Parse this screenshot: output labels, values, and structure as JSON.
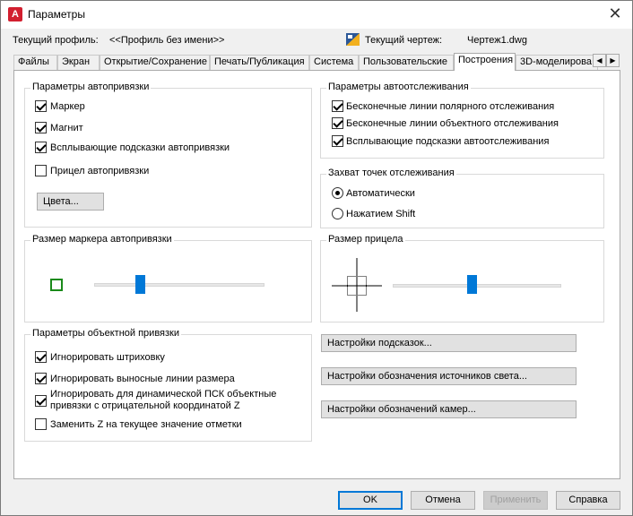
{
  "window": {
    "title": "Параметры",
    "app_icon_letter": "A"
  },
  "header": {
    "profile_label": "Текущий профиль:",
    "profile_value": "<<Профиль без имени>>",
    "drawing_label": "Текущий чертеж:",
    "drawing_value": "Чертеж1.dwg"
  },
  "tabs": [
    {
      "label": "Файлы"
    },
    {
      "label": "Экран"
    },
    {
      "label": "Открытие/Сохранение"
    },
    {
      "label": "Печать/Публикация"
    },
    {
      "label": "Система"
    },
    {
      "label": "Пользовательские"
    },
    {
      "label": "Построения",
      "active": true
    },
    {
      "label": "3D-моделирова"
    }
  ],
  "autosnap": {
    "title": "Параметры автопривязки",
    "marker": {
      "label": "Маркер",
      "checked": true
    },
    "magnet": {
      "label": "Магнит",
      "checked": true
    },
    "tooltips": {
      "label": "Всплывающие подсказки автопривязки",
      "checked": true
    },
    "aperture": {
      "label": "Прицел автопривязки",
      "checked": false
    },
    "colors_button": "Цвета..."
  },
  "autotrack": {
    "title": "Параметры автоотслеживания",
    "polar": {
      "label": "Бесконечные линии полярного отслеживания",
      "checked": true
    },
    "object": {
      "label": "Бесконечные линии объектного отслеживания",
      "checked": true
    },
    "tooltips": {
      "label": "Всплывающие подсказки автоотслеживания",
      "checked": true
    }
  },
  "acquisition": {
    "title": "Захват точек отслеживания",
    "auto": {
      "label": "Автоматически",
      "selected": true
    },
    "shift": {
      "label": "Нажатием Shift",
      "selected": false
    }
  },
  "marker_size": {
    "title": "Размер маркера автопривязки",
    "value_fraction": 0.27,
    "marker_color": "#1a8a1a"
  },
  "aperture_size": {
    "title": "Размер прицела",
    "value_fraction": 0.47
  },
  "osnap": {
    "title": "Параметры объектной привязки",
    "hatch": {
      "label": "Игнорировать штриховку",
      "checked": true
    },
    "dim_ext": {
      "label": "Игнорировать выносные линии размера",
      "checked": true
    },
    "dyn_ucs_line1": "Игнорировать для динамической ПСК объектные",
    "dyn_ucs_line2": "привязки с отрицательной координатой Z",
    "dyn_ucs_checked": true,
    "replace_z": {
      "label": "Заменить Z на текущее значение отметки",
      "checked": false
    }
  },
  "buttons": {
    "tooltip_settings": "Настройки подсказок...",
    "light_glyph": "Настройки обозначения источников света...",
    "camera_glyph": "Настройки обозначений камер..."
  },
  "footer": {
    "ok": "OK",
    "cancel": "Отмена",
    "apply": "Применить",
    "help": "Справка"
  },
  "colors": {
    "accent": "#0078d7",
    "app_icon": "#d21f2f"
  }
}
